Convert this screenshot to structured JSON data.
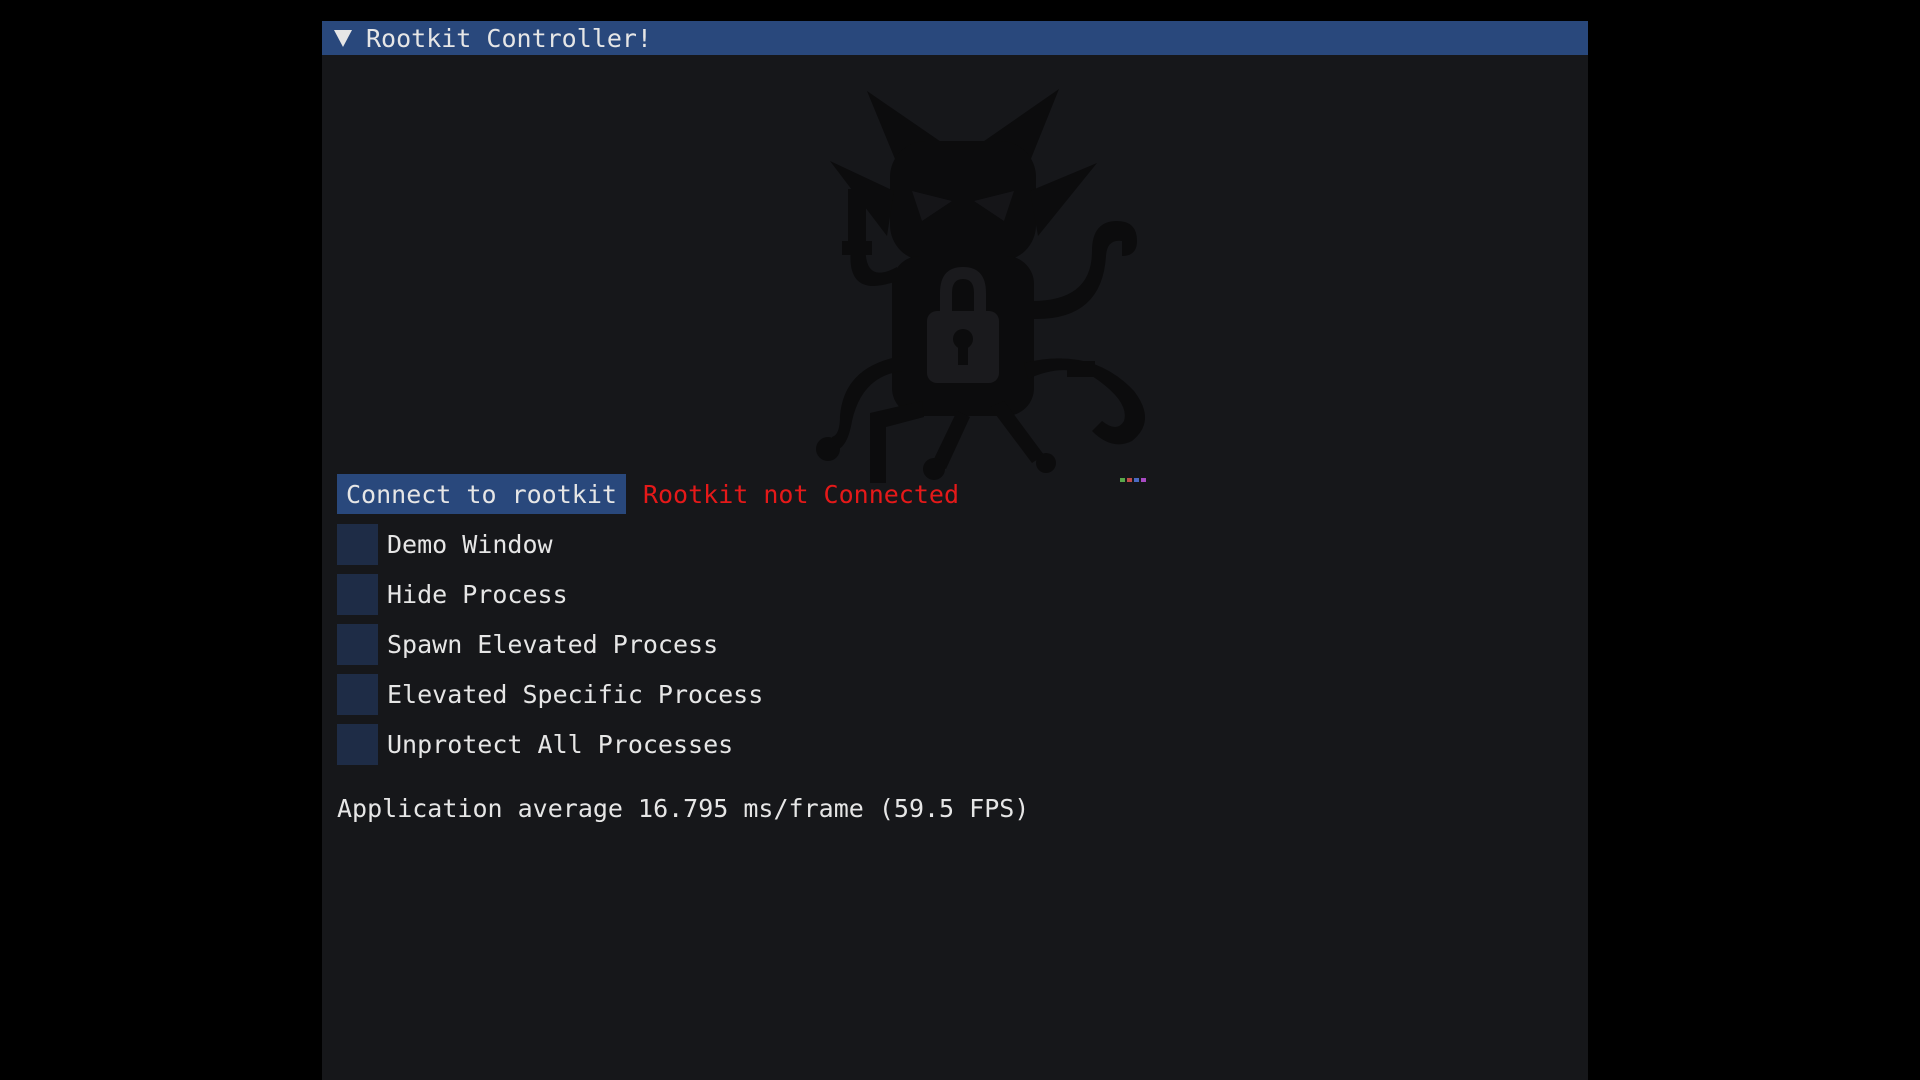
{
  "window": {
    "title": "Rootkit Controller!"
  },
  "controls": {
    "connect_label": "Connect to rootkit",
    "status": "Rootkit not Connected",
    "status_color": "#e51919",
    "checkboxes": [
      {
        "label": "Demo Window",
        "checked": false
      },
      {
        "label": "Hide Process",
        "checked": false
      },
      {
        "label": "Spawn Elevated Process",
        "checked": false
      },
      {
        "label": "Elevated Specific Process",
        "checked": false
      },
      {
        "label": "Unprotect All Processes",
        "checked": false
      }
    ]
  },
  "footer": {
    "fps_text": "Application average 16.795 ms/frame (59.5 FPS)"
  },
  "colors": {
    "accent": "#29487c",
    "window_bg": "#16171a",
    "checkbox_bg": "#1e2c46",
    "text": "#e6e6e6"
  },
  "icons": {
    "collapse": "triangle-down-icon",
    "logo": "devil-octopus-padlock-logo"
  }
}
